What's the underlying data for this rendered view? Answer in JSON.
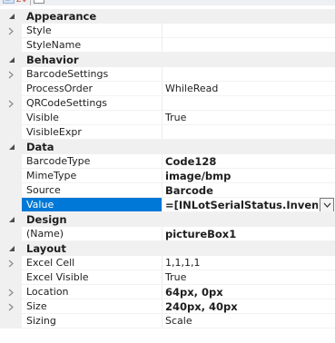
{
  "toolbar": {
    "sort_icon_glyph": "≡",
    "az_icon_glyph": "Z↓"
  },
  "categories": [
    {
      "label": "Appearance",
      "properties": [
        {
          "name": "Style",
          "value": "",
          "expandable": true,
          "bold": false
        },
        {
          "name": "StyleName",
          "value": "",
          "expandable": false,
          "bold": false
        }
      ]
    },
    {
      "label": "Behavior",
      "properties": [
        {
          "name": "BarcodeSettings",
          "value": "",
          "expandable": true,
          "bold": false
        },
        {
          "name": "ProcessOrder",
          "value": "WhileRead",
          "expandable": false,
          "bold": false
        },
        {
          "name": "QRCodeSettings",
          "value": "",
          "expandable": true,
          "bold": false
        },
        {
          "name": "Visible",
          "value": "True",
          "expandable": false,
          "bold": false
        },
        {
          "name": "VisibleExpr",
          "value": "",
          "expandable": false,
          "bold": false
        }
      ]
    },
    {
      "label": "Data",
      "properties": [
        {
          "name": "BarcodeType",
          "value": "Code128",
          "expandable": false,
          "bold": true
        },
        {
          "name": "MimeType",
          "value": "image/bmp",
          "expandable": false,
          "bold": true
        },
        {
          "name": "Source",
          "value": "Barcode",
          "expandable": false,
          "bold": true
        },
        {
          "name": "Value",
          "value": "=[INLotSerialStatus.InventoryI",
          "expandable": false,
          "bold": true,
          "selected": true
        }
      ]
    },
    {
      "label": "Design",
      "properties": [
        {
          "name": "(Name)",
          "value": "pictureBox1",
          "expandable": false,
          "bold": true
        }
      ]
    },
    {
      "label": "Layout",
      "properties": [
        {
          "name": "Excel Cell",
          "value": "1,1,1,1",
          "expandable": true,
          "bold": false
        },
        {
          "name": "Excel Visible",
          "value": "True",
          "expandable": false,
          "bold": false
        },
        {
          "name": "Location",
          "value": "64px, 0px",
          "expandable": true,
          "bold": true
        },
        {
          "name": "Size",
          "value": "240px, 40px",
          "expandable": true,
          "bold": true
        },
        {
          "name": "Sizing",
          "value": "Scale",
          "expandable": false,
          "bold": false
        }
      ]
    }
  ]
}
